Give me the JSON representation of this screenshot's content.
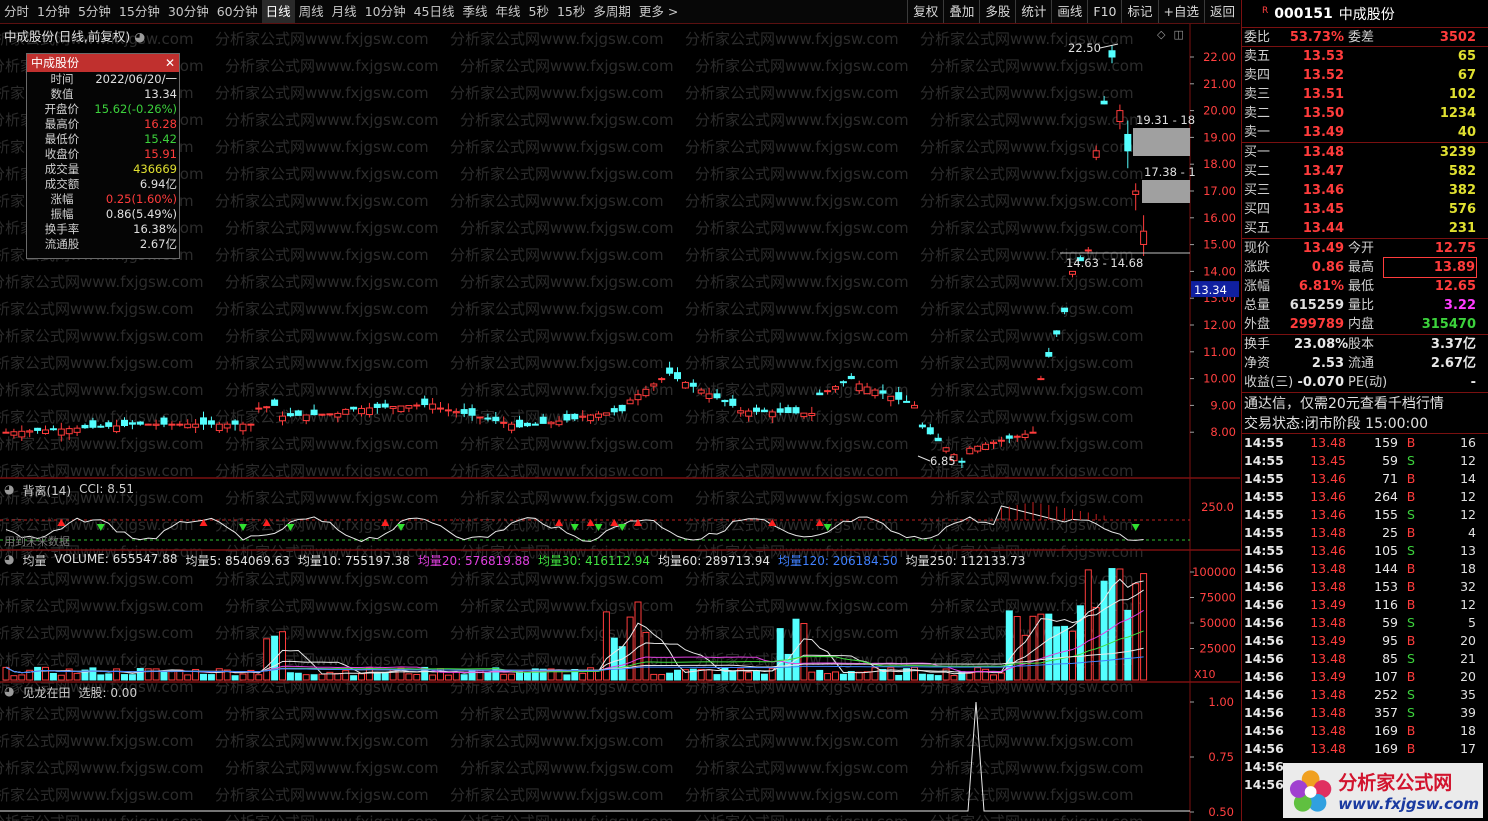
{
  "toolbar": {
    "periods": [
      "分时",
      "1分钟",
      "5分钟",
      "15分钟",
      "30分钟",
      "60分钟",
      "日线",
      "周线",
      "月线",
      "10分钟",
      "45日线",
      "季线",
      "年线",
      "5秒",
      "15秒",
      "多周期",
      "更多 >"
    ],
    "active_period": "日线",
    "tools": [
      "复权",
      "叠加",
      "多股",
      "统计",
      "画线",
      "F10",
      "标记",
      "+自选",
      "返回"
    ]
  },
  "chart": {
    "title": "中成股份(日线,前复权)",
    "watermark": "分析家公式网www.fxjgsw.com",
    "price_axis": [
      "22.00",
      "21.00",
      "20.00",
      "19.00",
      "18.00",
      "17.00",
      "16.00",
      "15.00",
      "14.00",
      "13.00",
      "12.00",
      "11.00",
      "10.00",
      "9.00",
      "8.00"
    ],
    "current_price_tag": "13.34",
    "annotations": {
      "high": "22.50",
      "low": "6.85",
      "gap1": "19.31 - 18",
      "gap2": "17.38 - 1",
      "gap3": "14.63 - 14.68"
    },
    "cci_title": "背离(14)",
    "cci_value": "CCI: 8.51",
    "cci_axis": "250.0",
    "cci_note": "用到未来数据",
    "vol_title": "均量",
    "vol_items": [
      {
        "text": "VOLUME: 655547.88",
        "color": "#e0e0e0"
      },
      {
        "text": "均量5: 854069.63",
        "color": "#e0e0e0"
      },
      {
        "text": "均量10: 755197.38",
        "color": "#e0e0e0"
      },
      {
        "text": "均量20: 576819.88",
        "color": "#e040e0"
      },
      {
        "text": "均量30: 416112.94",
        "color": "#40e040"
      },
      {
        "text": "均量60: 289713.94",
        "color": "#e0e0e0"
      },
      {
        "text": "均量120: 206184.50",
        "color": "#4080ff"
      },
      {
        "text": "均量250: 112133.73",
        "color": "#e0e0e0"
      }
    ],
    "vol_axis": [
      "100000",
      "75000",
      "50000",
      "25000"
    ],
    "vol_unit": "X10",
    "jl_title": "见龙在田",
    "jl_value": "选股: 0.00",
    "jl_axis": [
      "1.00",
      "0.75",
      "0.50"
    ]
  },
  "info": {
    "title": "中成股份",
    "rows": [
      {
        "k": "时间",
        "v": "2022/06/20/一",
        "c": "#e0e0e0"
      },
      {
        "k": "数值",
        "v": "13.34",
        "c": "#e0e0e0"
      },
      {
        "k": "开盘价",
        "v": "15.62(-0.26%)",
        "c": "#3cd23c"
      },
      {
        "k": "最高价",
        "v": "16.28",
        "c": "#ff3c3c"
      },
      {
        "k": "最低价",
        "v": "15.42",
        "c": "#3cd23c"
      },
      {
        "k": "收盘价",
        "v": "15.91",
        "c": "#ff3c3c"
      },
      {
        "k": "成交量",
        "v": "436669",
        "c": "#e0e030"
      },
      {
        "k": "成交额",
        "v": "6.94亿",
        "c": "#e0e0e0"
      },
      {
        "k": "涨幅",
        "v": "0.25(1.60%)",
        "c": "#ff3c3c"
      },
      {
        "k": "振幅",
        "v": "0.86(5.49%)",
        "c": "#e0e0e0"
      },
      {
        "k": "换手率",
        "v": "16.38%",
        "c": "#e0e0e0"
      },
      {
        "k": "流通股",
        "v": "2.67亿",
        "c": "#e0e0e0"
      }
    ]
  },
  "quote": {
    "badge": "R",
    "code": "000151",
    "name": "中成股份",
    "weibi": {
      "label": "委比",
      "value": "53.73%",
      "label2": "委差",
      "value2": "3502"
    },
    "asks": [
      {
        "label": "卖五",
        "price": "13.53",
        "vol": "65"
      },
      {
        "label": "卖四",
        "price": "13.52",
        "vol": "67"
      },
      {
        "label": "卖三",
        "price": "13.51",
        "vol": "102"
      },
      {
        "label": "卖二",
        "price": "13.50",
        "vol": "1234"
      },
      {
        "label": "卖一",
        "price": "13.49",
        "vol": "40"
      }
    ],
    "bids": [
      {
        "label": "买一",
        "price": "13.48",
        "vol": "3239"
      },
      {
        "label": "买二",
        "price": "13.47",
        "vol": "582"
      },
      {
        "label": "买三",
        "price": "13.46",
        "vol": "382"
      },
      {
        "label": "买四",
        "price": "13.45",
        "vol": "576"
      },
      {
        "label": "买五",
        "price": "13.44",
        "vol": "231"
      }
    ],
    "stats": [
      {
        "l1": "现价",
        "v1": "13.49",
        "c1": "#ff3c3c",
        "l2": "今开",
        "v2": "12.75",
        "c2": "#ff3c3c"
      },
      {
        "l1": "涨跌",
        "v1": "0.86",
        "c1": "#ff3c3c",
        "l2": "最高",
        "v2": "13.89",
        "c2": "#ff3c3c"
      },
      {
        "l1": "涨幅",
        "v1": "6.81%",
        "c1": "#ff3c3c",
        "l2": "最低",
        "v2": "12.65",
        "c2": "#ff3c3c"
      },
      {
        "l1": "总量",
        "v1": "615259",
        "c1": "#e0e0e0",
        "l2": "量比",
        "v2": "3.22",
        "c2": "#ff3cff"
      },
      {
        "l1": "外盘",
        "v1": "299789",
        "c1": "#ff3c3c",
        "l2": "内盘",
        "v2": "315470",
        "c2": "#3cd23c"
      }
    ],
    "stats2": [
      {
        "l1": "换手",
        "v1": "23.08%",
        "l2": "股本",
        "v2": "3.37亿"
      },
      {
        "l1": "净资",
        "v1": "2.53",
        "l2": "流通",
        "v2": "2.67亿"
      },
      {
        "l1": "收益(三)",
        "v1": "-0.070",
        "l2": "PE(动)",
        "v2": "-"
      }
    ],
    "notice": "通达信，仅需20元查看千档行情",
    "market_status": "交易状态:闭市阶段 15:00:00",
    "ticks": [
      {
        "t": "14:55",
        "p": "13.48",
        "v": "159",
        "bs": "B",
        "n": "16"
      },
      {
        "t": "14:55",
        "p": "13.45",
        "v": "59",
        "bs": "S",
        "n": "12"
      },
      {
        "t": "14:55",
        "p": "13.46",
        "v": "71",
        "bs": "B",
        "n": "14"
      },
      {
        "t": "14:55",
        "p": "13.46",
        "v": "264",
        "bs": "B",
        "n": "12"
      },
      {
        "t": "14:55",
        "p": "13.46",
        "v": "155",
        "bs": "S",
        "n": "12"
      },
      {
        "t": "14:55",
        "p": "13.48",
        "v": "25",
        "bs": "B",
        "n": "4"
      },
      {
        "t": "14:55",
        "p": "13.46",
        "v": "105",
        "bs": "S",
        "n": "13"
      },
      {
        "t": "14:56",
        "p": "13.48",
        "v": "144",
        "bs": "B",
        "n": "18"
      },
      {
        "t": "14:56",
        "p": "13.48",
        "v": "153",
        "bs": "B",
        "n": "32"
      },
      {
        "t": "14:56",
        "p": "13.49",
        "v": "116",
        "bs": "B",
        "n": "12"
      },
      {
        "t": "14:56",
        "p": "13.48",
        "v": "59",
        "bs": "S",
        "n": "5"
      },
      {
        "t": "14:56",
        "p": "13.49",
        "v": "95",
        "bs": "B",
        "n": "20"
      },
      {
        "t": "14:56",
        "p": "13.48",
        "v": "85",
        "bs": "S",
        "n": "21"
      },
      {
        "t": "14:56",
        "p": "13.49",
        "v": "107",
        "bs": "B",
        "n": "20"
      },
      {
        "t": "14:56",
        "p": "13.48",
        "v": "252",
        "bs": "S",
        "n": "35"
      },
      {
        "t": "14:56",
        "p": "13.48",
        "v": "357",
        "bs": "S",
        "n": "39"
      },
      {
        "t": "14:56",
        "p": "13.48",
        "v": "169",
        "bs": "B",
        "n": "18"
      },
      {
        "t": "14:56",
        "p": "13.48",
        "v": "169",
        "bs": "B",
        "n": "17"
      },
      {
        "t": "14:56",
        "p": "",
        "v": "",
        "bs": "",
        "n": ""
      },
      {
        "t": "14:56",
        "p": "",
        "v": "",
        "bs": "",
        "n": ""
      }
    ]
  },
  "logo": {
    "main": "分析家公式网",
    "url": "www.fxjgsw.com"
  },
  "colors": {
    "up": "#ff3c3c",
    "down": "#54ffff",
    "grid": "#7a1010",
    "bg": "#000000"
  },
  "icons": [
    "close-icon",
    "diamond-icon",
    "panel-icon",
    "circle-toggle-icon",
    "logo-flower-icon"
  ]
}
